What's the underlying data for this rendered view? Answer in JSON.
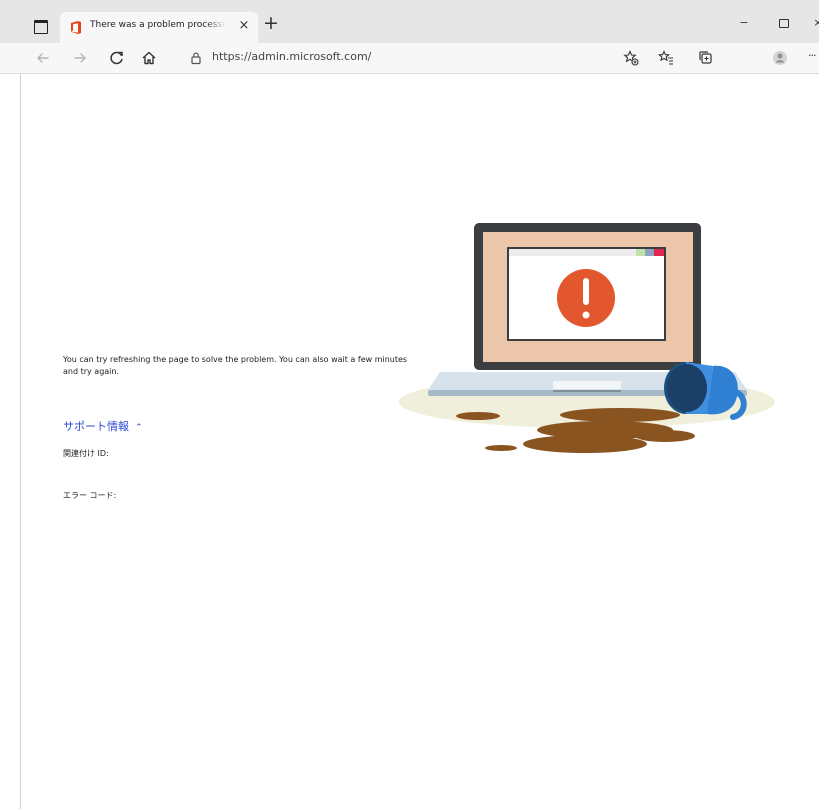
{
  "browser": {
    "tab": {
      "title": "There was a problem processing",
      "close_glyph": "×"
    },
    "new_tab_glyph": "+",
    "address_bar": {
      "url": "https://admin.microsoft.com/"
    },
    "window_controls": {
      "minimize_glyph": "−",
      "close_glyph": "×"
    },
    "more_glyph": "···"
  },
  "page": {
    "message": "You can try refreshing the page to solve the problem. You can also wait a few minutes and try again.",
    "support_toggle_label": "サポート情報",
    "support_toggle_caret": "⌃",
    "correlation_id_label": "関連付け ID:",
    "error_code_label": "エラー コード:"
  },
  "colors": {
    "tabstrip_bg": "#e6e6e6",
    "toolbar_bg": "#f7f7f7",
    "link_blue": "#2a4bd6",
    "office_red": "#e6441f",
    "screen_peach": "#ecc6ab",
    "alert_orange": "#e2572d",
    "mug_blue": "#2f7fd3",
    "coffee_brown": "#8a5420"
  },
  "icons": {
    "tab_actions": "tab-actions-icon",
    "favicon": "office-logo-icon",
    "back": "back-arrow-icon",
    "forward": "forward-arrow-icon",
    "refresh": "refresh-icon",
    "home": "home-icon",
    "lock": "lock-icon",
    "favorite_add": "add-favorite-icon",
    "favorites": "favorites-icon",
    "collections": "collections-icon",
    "profile": "profile-icon"
  }
}
